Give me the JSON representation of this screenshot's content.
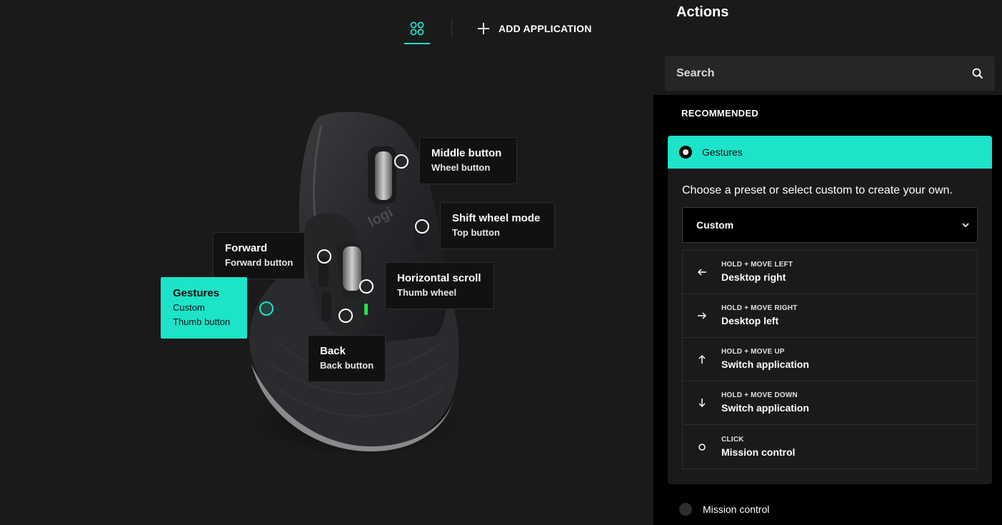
{
  "header": {
    "add_application_label": "ADD APPLICATION"
  },
  "callouts": {
    "middle": {
      "title": "Middle button",
      "sub": "Wheel button"
    },
    "shift": {
      "title": "Shift wheel mode",
      "sub": "Top button"
    },
    "forward": {
      "title": "Forward",
      "sub": "Forward button"
    },
    "gestures": {
      "title": "Gestures",
      "action": "Custom",
      "sub": "Thumb button"
    },
    "hscroll": {
      "title": "Horizontal scroll",
      "sub": "Thumb wheel"
    },
    "back": {
      "title": "Back",
      "sub": "Back button"
    }
  },
  "mouse": {
    "logo_text": "logi"
  },
  "panel": {
    "title": "Actions",
    "search_placeholder": "Search",
    "section_label": "RECOMMENDED",
    "selected_action": {
      "name": "Gestures",
      "description": "Choose a preset or select custom to create your own.",
      "preset": "Custom",
      "gestures": [
        {
          "icon": "arrow-left-icon",
          "hint": "HOLD + MOVE LEFT",
          "action": "Desktop right"
        },
        {
          "icon": "arrow-right-icon",
          "hint": "HOLD + MOVE RIGHT",
          "action": "Desktop left"
        },
        {
          "icon": "arrow-up-icon",
          "hint": "HOLD + MOVE UP",
          "action": "Switch application"
        },
        {
          "icon": "arrow-down-icon",
          "hint": "HOLD + MOVE DOWN",
          "action": "Switch application"
        },
        {
          "icon": "circle-icon",
          "hint": "CLICK",
          "action": "Mission control"
        }
      ]
    },
    "other_action": {
      "name": "Mission control"
    }
  },
  "colors": {
    "accent": "#1de3c9",
    "background": "#1a1a1a",
    "panel": "#000000"
  }
}
